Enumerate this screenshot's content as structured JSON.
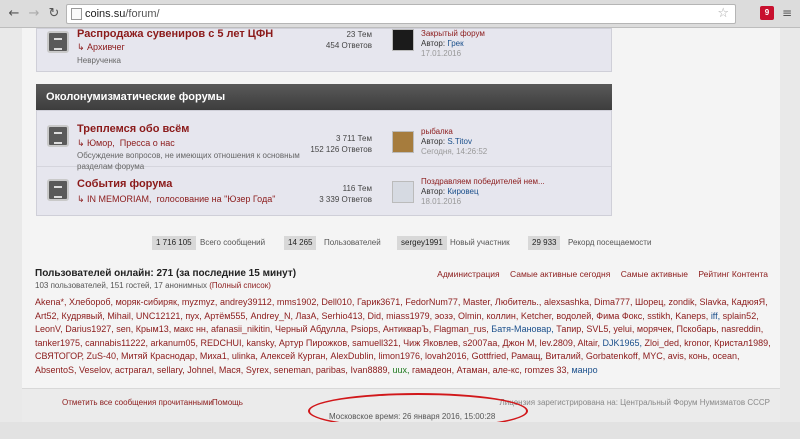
{
  "browser": {
    "url_host": "coins.su",
    "url_path": "/forum/",
    "extension_badge": "9"
  },
  "forum_top": {
    "title": "Распродажа сувениров с 5 лет ЦФН",
    "subforum": "Архивчег",
    "description": "Неврученка",
    "topics": "23 Тем",
    "replies": "454 Ответов",
    "last_title": "Закрытый форум",
    "last_author_label": "Автор:",
    "last_author": "Грек",
    "last_date": "17.01.2016"
  },
  "section": {
    "title": "Околонумизматические форумы"
  },
  "forums": [
    {
      "title": "Треплемся обо всём",
      "subforums": [
        "Юмор,",
        "Пресса о нас"
      ],
      "description": "Обсуждение вопросов, не имеющих отношения к основным разделам форума",
      "topics": "3 711 Тем",
      "replies": "152 126 Ответов",
      "last_title": "рыбалка",
      "last_author_label": "Автор:",
      "last_author": "S.Titov",
      "last_date": "Сегодня, 14:26:52"
    },
    {
      "title": "События форума",
      "subforums": [
        "IN MEMORIAM,",
        "голосование на \"Юзер Года\""
      ],
      "topics": "116 Тем",
      "replies": "3 339 Ответов",
      "last_title": "Поздравляем победителей нем...",
      "last_author_label": "Автор:",
      "last_author": "Кировец",
      "last_date": "18.01.2016"
    }
  ],
  "stats": {
    "messages_value": "1 716 105",
    "messages_label": "Всего сообщений",
    "users_value": "14 265",
    "users_label": "Пользователей",
    "newest_value": "sergey1991",
    "newest_label": "Новый участник",
    "record_value": "29 933",
    "record_label": "Рекорд посещаемости"
  },
  "online": {
    "title": "Пользователей онлайн: 271 (за последние 15 минут)",
    "subtitle": "103 пользователей, 151 гостей, 17 анонимных",
    "full_list": "(Полный список)",
    "links": [
      "Администрация",
      "Самые активные сегодня",
      "Самые активные",
      "Рейтинг Контента"
    ],
    "users": [
      {
        "n": "Akena*,",
        "c": "#8b1a1a"
      },
      {
        "n": "Хлебороб,",
        "c": "#8b1a1a"
      },
      {
        "n": "моряк-сибиряк,",
        "c": "#8b1a1a"
      },
      {
        "n": "myzmyz,",
        "c": "#8b1a1a"
      },
      {
        "n": "andrey39112,",
        "c": "#8b1a1a"
      },
      {
        "n": "mms1902,",
        "c": "#8b1a1a"
      },
      {
        "n": "Dell010,",
        "c": "#8b1a1a"
      },
      {
        "n": "Гарик3671,",
        "c": "#8b1a1a"
      },
      {
        "n": "FedorNum77,",
        "c": "#8b1a1a"
      },
      {
        "n": "Master,",
        "c": "#8b1a1a"
      },
      {
        "n": "Любитель.,",
        "c": "#8b1a1a"
      },
      {
        "n": "alexsashka,",
        "c": "#8b1a1a"
      },
      {
        "n": "Dima777,",
        "c": "#8b1a1a"
      },
      {
        "n": "Шорец,",
        "c": "#8b1a1a"
      },
      {
        "n": "zondik,",
        "c": "#8b1a1a"
      },
      {
        "n": "Slavka,",
        "c": "#8b1a1a"
      },
      {
        "n": "КадюяЯ,",
        "c": "#8b1a1a"
      },
      {
        "n": "Art52,",
        "c": "#8b1a1a"
      },
      {
        "n": "Кудрявый,",
        "c": "#8b1a1a"
      },
      {
        "n": "Mihail,",
        "c": "#8b1a1a"
      },
      {
        "n": "UNC12121,",
        "c": "#8b1a1a"
      },
      {
        "n": "пух,",
        "c": "#8b1a1a"
      },
      {
        "n": "Артём555,",
        "c": "#8b1a1a"
      },
      {
        "n": "Andrey_N,",
        "c": "#8b1a1a"
      },
      {
        "n": "ЛазА,",
        "c": "#8b1a1a"
      },
      {
        "n": "Serhio413,",
        "c": "#8b1a1a"
      },
      {
        "n": "Did,",
        "c": "#8b1a1a"
      },
      {
        "n": "miass1979,",
        "c": "#8b1a1a"
      },
      {
        "n": "эозэ,",
        "c": "#8b1a1a"
      },
      {
        "n": "Olmin,",
        "c": "#8b1a1a"
      },
      {
        "n": "коллин,",
        "c": "#8b1a1a"
      },
      {
        "n": "Ketcher,",
        "c": "#8b1a1a"
      },
      {
        "n": "водолей,",
        "c": "#8b1a1a"
      },
      {
        "n": "Фима Фокс,",
        "c": "#8b1a1a"
      },
      {
        "n": "sstikh,",
        "c": "#8b1a1a"
      },
      {
        "n": "Kaneps,",
        "c": "#8b1a1a"
      },
      {
        "n": "iff,",
        "c": "#1a4f8b"
      },
      {
        "n": "splain52,",
        "c": "#8b1a1a"
      },
      {
        "n": "LeonV,",
        "c": "#8b1a1a"
      },
      {
        "n": "Darius1927,",
        "c": "#8b1a1a"
      },
      {
        "n": "sen,",
        "c": "#8b1a1a"
      },
      {
        "n": "Крым13,",
        "c": "#8b1a1a"
      },
      {
        "n": "макс нн,",
        "c": "#8b1a1a"
      },
      {
        "n": "afanasii_nikitin,",
        "c": "#8b1a1a"
      },
      {
        "n": "Черный Абдулла,",
        "c": "#8b1a1a"
      },
      {
        "n": "Psiops,",
        "c": "#8b1a1a"
      },
      {
        "n": "АнтикварЪ,",
        "c": "#8b1a1a"
      },
      {
        "n": "Flagman_rus,",
        "c": "#8b1a1a"
      },
      {
        "n": "Батя-Мановар,",
        "c": "#1a4f8b"
      },
      {
        "n": "Тапир,",
        "c": "#8b1a1a"
      },
      {
        "n": "SVL5,",
        "c": "#8b1a1a"
      },
      {
        "n": "yelui,",
        "c": "#8b1a1a"
      },
      {
        "n": "морячек,",
        "c": "#8b1a1a"
      },
      {
        "n": "Пскобарь,",
        "c": "#8b1a1a"
      },
      {
        "n": "nasreddin,",
        "c": "#8b1a1a"
      },
      {
        "n": "tanker1975,",
        "c": "#8b1a1a"
      },
      {
        "n": "cannabis11222,",
        "c": "#8b1a1a"
      },
      {
        "n": "arkanum05,",
        "c": "#8b1a1a"
      },
      {
        "n": "REDCHUI,",
        "c": "#8b1a1a"
      },
      {
        "n": "kansky,",
        "c": "#8b1a1a"
      },
      {
        "n": "Артур Пирожков,",
        "c": "#8b1a1a"
      },
      {
        "n": "samuell321,",
        "c": "#8b1a1a"
      },
      {
        "n": "Чиж Яковлев,",
        "c": "#8b1a1a"
      },
      {
        "n": "s2007aa,",
        "c": "#8b1a1a"
      },
      {
        "n": "Джон М,",
        "c": "#8b1a1a"
      },
      {
        "n": "lev.2809,",
        "c": "#8b1a1a"
      },
      {
        "n": "Altair,",
        "c": "#8b1a1a"
      },
      {
        "n": "DJK1965,",
        "c": "#1a4f8b"
      },
      {
        "n": "Zloi_ded,",
        "c": "#8b1a1a"
      },
      {
        "n": "kronor,",
        "c": "#8b1a1a"
      },
      {
        "n": "Кристал1989,",
        "c": "#8b1a1a"
      },
      {
        "n": "СВЯТОГОР,",
        "c": "#8b1a1a"
      },
      {
        "n": "ZuS-40,",
        "c": "#8b1a1a"
      },
      {
        "n": "Митяй Краснодар,",
        "c": "#8b1a1a"
      },
      {
        "n": "Миха1,",
        "c": "#8b1a1a"
      },
      {
        "n": "ulinka,",
        "c": "#8b1a1a"
      },
      {
        "n": "Алексей Курган,",
        "c": "#8b1a1a"
      },
      {
        "n": "AlexDublin,",
        "c": "#8b1a1a"
      },
      {
        "n": "limon1976,",
        "c": "#8b1a1a"
      },
      {
        "n": "lovah2016,",
        "c": "#8b1a1a"
      },
      {
        "n": "Gottfried,",
        "c": "#8b1a1a"
      },
      {
        "n": "Рамащ,",
        "c": "#8b1a1a"
      },
      {
        "n": "Виталий,",
        "c": "#8b1a1a"
      },
      {
        "n": "Gorbatenkoff,",
        "c": "#8b1a1a"
      },
      {
        "n": "MYC,",
        "c": "#8b1a1a"
      },
      {
        "n": "avis,",
        "c": "#8b1a1a"
      },
      {
        "n": "конь,",
        "c": "#8b1a1a"
      },
      {
        "n": "ocean,",
        "c": "#8b1a1a"
      },
      {
        "n": "AbsentoS,",
        "c": "#8b1a1a"
      },
      {
        "n": "Veselov,",
        "c": "#8b1a1a"
      },
      {
        "n": "астрагал,",
        "c": "#8b1a1a"
      },
      {
        "n": "sellary,",
        "c": "#8b1a1a"
      },
      {
        "n": "Johnel,",
        "c": "#8b1a1a"
      },
      {
        "n": "Мася,",
        "c": "#8b1a1a"
      },
      {
        "n": "Syrex,",
        "c": "#8b1a1a"
      },
      {
        "n": "seneman,",
        "c": "#8b1a1a"
      },
      {
        "n": "paribas,",
        "c": "#8b1a1a"
      },
      {
        "n": "Ivan8889,",
        "c": "#8b1a1a"
      },
      {
        "n": "uux,",
        "c": "#1e7a1e"
      },
      {
        "n": "гамадеон,",
        "c": "#8b1a1a"
      },
      {
        "n": "Атаман,",
        "c": "#8b1a1a"
      },
      {
        "n": "але-кс,",
        "c": "#8b1a1a"
      },
      {
        "n": "romzes 33,",
        "c": "#8b1a1a"
      },
      {
        "n": "манро",
        "c": "#1a4f8b"
      }
    ]
  },
  "footer": {
    "mark_read": "Отметить все сообщения прочитанными",
    "help": "Помощь",
    "license": "Лицензия зарегистрирована на: Центральный Форум Нумизматов СССР",
    "server_time": "Московское время: 26 января 2016, 15:00:28"
  },
  "colors": {
    "accent": "#8b1a1a",
    "highlight_ellipse": "#d1171a"
  }
}
